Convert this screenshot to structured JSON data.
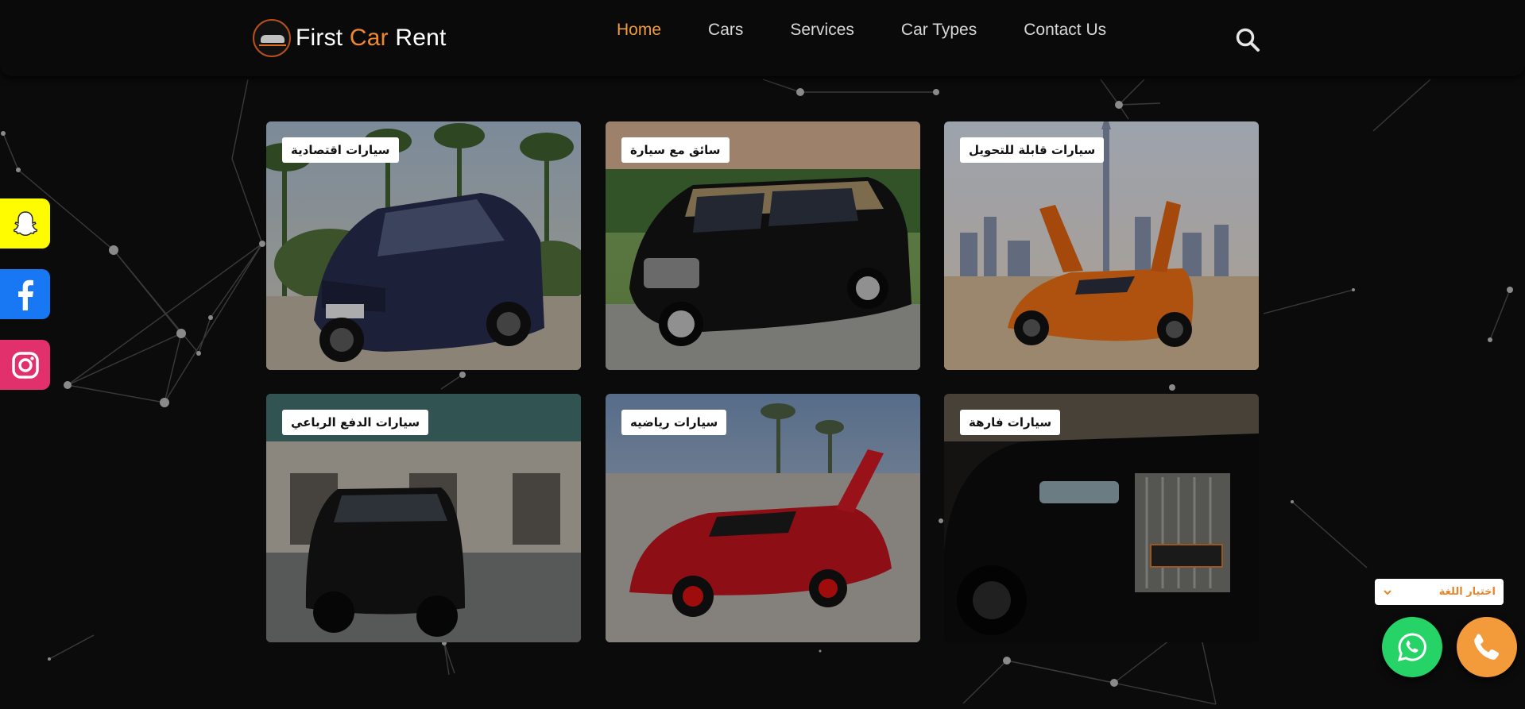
{
  "brand": {
    "first": "First",
    "car": "Car",
    "rent": "Rent",
    "logo_icon": "car-logo"
  },
  "nav": {
    "items": [
      {
        "label": "Home",
        "active": true
      },
      {
        "label": "Cars"
      },
      {
        "label": "Services"
      },
      {
        "label": "Car Types"
      },
      {
        "label": "Contact Us"
      }
    ],
    "search_icon": "search-icon"
  },
  "categories": [
    {
      "label": "سيارات اقتصادية"
    },
    {
      "label": "سائق مع سيارة"
    },
    {
      "label": "سيارات قابلة للتحويل"
    },
    {
      "label": "سيارات الدفع الرباعي"
    },
    {
      "label": "سيارات رياضيه"
    },
    {
      "label": "سيارات فارهة"
    }
  ],
  "social": [
    {
      "name": "snapchat",
      "icon": "snapchat-icon",
      "color": "#fffc00"
    },
    {
      "name": "facebook",
      "icon": "facebook-icon",
      "color": "#1877f2"
    },
    {
      "name": "instagram",
      "icon": "instagram-icon",
      "color": "#e1306c"
    }
  ],
  "language": {
    "label": "اختيار اللغة",
    "icon": "chevron-down-icon"
  },
  "contact_buttons": {
    "whatsapp_color": "#25d366",
    "phone_color": "#f39a3a"
  },
  "colors": {
    "accent": "#f39a3a",
    "background": "#0b0b0b"
  }
}
